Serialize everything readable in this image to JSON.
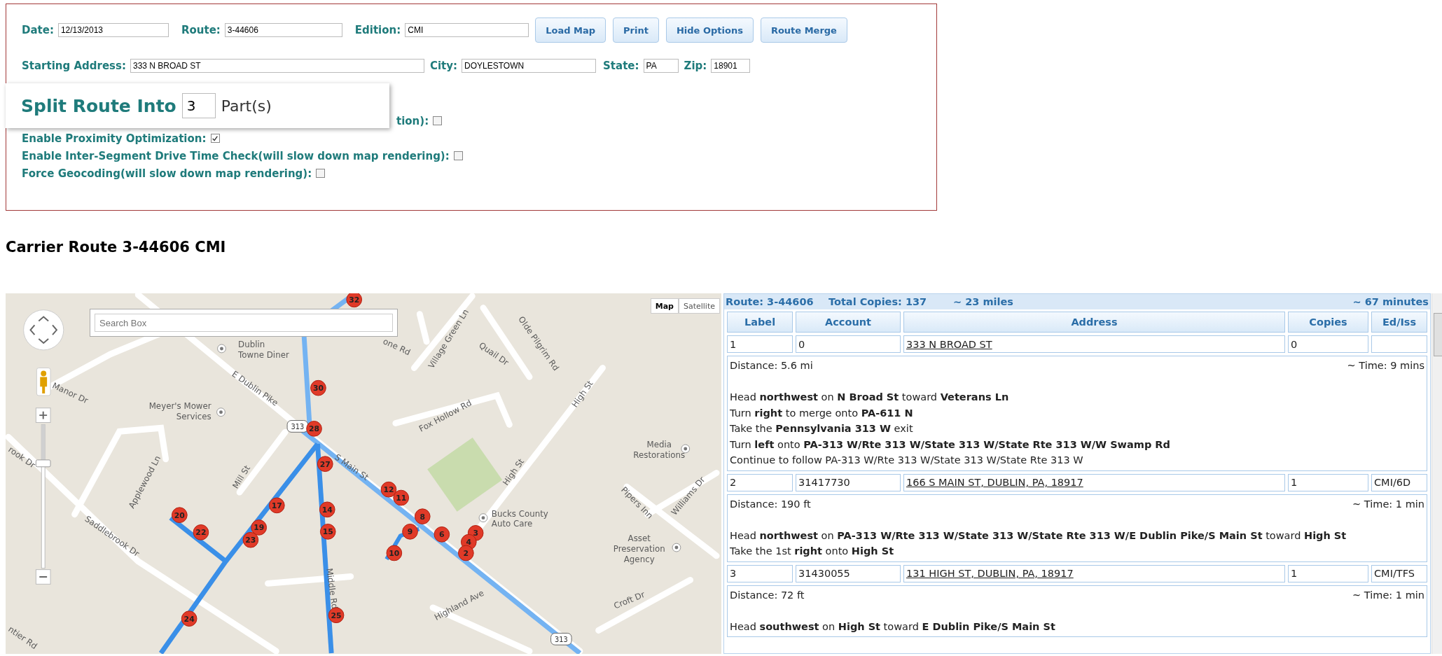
{
  "form": {
    "row1": [
      {
        "label": "Date:",
        "value": "12/13/2013"
      },
      {
        "label": "Route:",
        "value": "3-44606"
      },
      {
        "label": "Edition:",
        "value": "CMI"
      }
    ],
    "buttons": [
      "Load Map",
      "Print",
      "Hide Options",
      "Route Merge"
    ],
    "row2": [
      {
        "label": "Starting Address:",
        "value": "333 N BROAD ST"
      },
      {
        "label": "City:",
        "value": "DOYLESTOWN"
      },
      {
        "label": "State:",
        "value": "PA"
      },
      {
        "label": "Zip:",
        "value": "18901"
      }
    ],
    "split_popup": {
      "label": "Split Route Into",
      "value": "3",
      "suffix": "Part(s)"
    },
    "options": [
      {
        "kind": "covered",
        "label": "tion):",
        "checked": false
      },
      {
        "kind": "plain",
        "label": "Enable Proximity Optimization:",
        "checked": true
      },
      {
        "kind": "plain",
        "label": "Enable Inter-Segment Drive Time Check(will slow down map rendering):",
        "checked": false
      },
      {
        "kind": "plain",
        "label": "Force Geocoding(will slow down map rendering):",
        "checked": false
      }
    ]
  },
  "heading": "Carrier Route 3-44606 CMI",
  "map": {
    "search": {
      "placeholder": "Search Box"
    },
    "map_types": [
      {
        "label": "Map",
        "selected": true
      },
      {
        "label": "Satellite",
        "selected": false
      }
    ],
    "places": [
      {
        "kind": "street",
        "lines": [
          "E Dublin Pike"
        ]
      },
      {
        "kind": "poi",
        "lines": [
          "Dublin",
          "Towne Diner"
        ]
      },
      {
        "kind": "street",
        "lines": [
          "Manor Dr"
        ]
      },
      {
        "kind": "poi",
        "lines": [
          "Meyer's Mower",
          "Services"
        ]
      },
      {
        "kind": "street",
        "lines": [
          "Village Green Ln"
        ]
      },
      {
        "kind": "street",
        "lines": [
          "Quail Dr"
        ]
      },
      {
        "kind": "street",
        "lines": [
          "Olde Pilgrim Rd"
        ]
      },
      {
        "kind": "street",
        "lines": [
          "Fox Hollow Rd"
        ]
      },
      {
        "kind": "street",
        "lines": [
          "High St"
        ]
      },
      {
        "kind": "poi",
        "lines": [
          "Media",
          "Restorations"
        ]
      },
      {
        "kind": "street",
        "lines": [
          "S Main St"
        ]
      },
      {
        "kind": "street",
        "lines": [
          "Mill St"
        ]
      },
      {
        "kind": "street",
        "lines": [
          "Applewood Ln"
        ]
      },
      {
        "kind": "street",
        "lines": [
          "Saddlebrook Dr"
        ]
      },
      {
        "kind": "street",
        "lines": [
          "High St"
        ]
      },
      {
        "kind": "poi",
        "lines": [
          "Bucks County",
          "Auto Care"
        ]
      },
      {
        "kind": "poi",
        "lines": [
          "Asset",
          "Preservation",
          "Agency"
        ]
      },
      {
        "kind": "street",
        "lines": [
          "Williams Dr"
        ]
      },
      {
        "kind": "street",
        "lines": [
          "Pipers Inn"
        ]
      },
      {
        "kind": "street",
        "lines": [
          "Highland Ave"
        ]
      },
      {
        "kind": "street",
        "lines": [
          "Croft Dr"
        ]
      },
      {
        "kind": "street",
        "lines": [
          "Middle Rd"
        ]
      },
      {
        "kind": "street",
        "lines": [
          "one Rd"
        ]
      },
      {
        "kind": "street",
        "lines": [
          "rook Dr"
        ]
      },
      {
        "kind": "street",
        "lines": [
          "ntier Rd"
        ]
      }
    ],
    "shields": [
      "313",
      "313"
    ],
    "zoom_slider": {
      "level": 0.27
    },
    "markers": [
      "32",
      "30",
      "28",
      "27",
      "14",
      "15",
      "25",
      "17",
      "19",
      "23",
      "20",
      "22",
      "24",
      "12",
      "11",
      "8",
      "9",
      "6",
      "3",
      "4",
      "2",
      "10"
    ]
  },
  "route_panel": {
    "summary": [
      "Route: 3-44606",
      "Total Copies: 137",
      "~ 23 miles",
      "~ 67 minutes"
    ],
    "columns": [
      "Label",
      "Account",
      "Address",
      "Copies",
      "Ed/Iss"
    ],
    "stops": [
      {
        "label": "1",
        "account": "0",
        "address": "333 N BROAD ST",
        "copies": "0",
        "distance": "Distance: 5.6 mi",
        "time": "~ Time: 9 mins",
        "steps": [
          "Head **northwest** on **N Broad St** toward **Veterans Ln**",
          "Turn **right** to merge onto **PA-611 N**",
          "Take the **Pennsylvania 313 W** exit",
          "Turn **left** onto **PA-313 W/Rte 313 W/State 313 W/State Rte 313 W/W Swamp Rd**",
          "Continue to follow PA-313 W/Rte 313 W/State 313 W/State Rte 313 W"
        ]
      },
      {
        "label": "2",
        "account": "31417730",
        "address": "166 S MAIN ST, DUBLIN, PA, 18917",
        "copies": "1",
        "ed_iss": "CMI/6D",
        "distance": "Distance: 190 ft",
        "time": "~ Time: 1 min",
        "steps": [
          "Head **northwest** on **PA-313 W/Rte 313 W/State 313 W/State Rte 313 W/E Dublin Pike/S Main St** toward **High St**",
          "Take the 1st **right** onto **High St**"
        ]
      },
      {
        "label": "3",
        "account": "31430055",
        "address": "131 HIGH ST, DUBLIN, PA, 18917",
        "copies": "1",
        "ed_iss": "CMI/TFS",
        "distance": "Distance: 72 ft",
        "time": "~ Time: 1 min",
        "steps": [
          "Head **southwest** on **High St** toward **E Dublin Pike/S Main St**"
        ]
      }
    ]
  }
}
